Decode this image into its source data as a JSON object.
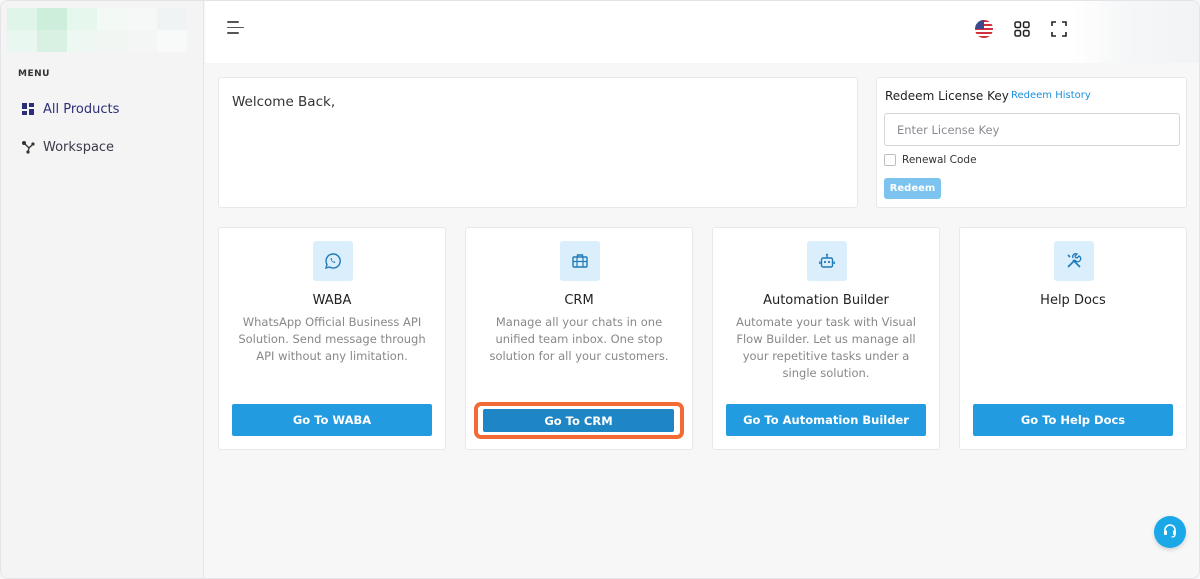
{
  "sidebar": {
    "menu_label": "MENU",
    "items": [
      {
        "label": "All Products",
        "icon": "grid-icon"
      },
      {
        "label": "Workspace",
        "icon": "nodes-icon"
      }
    ]
  },
  "topbar": {
    "language_icon": "us-flag-icon",
    "apps_icon": "apps-grid-icon",
    "fullscreen_icon": "fullscreen-icon"
  },
  "welcome": {
    "text": "Welcome Back,"
  },
  "redeem": {
    "title": "Redeem License Key",
    "history_link": "Redeem History",
    "input_placeholder": "Enter License Key",
    "input_value": "",
    "renewal_label": "Renewal Code",
    "button_label": "Redeem"
  },
  "products": [
    {
      "title": "WABA",
      "icon": "whatsapp-icon",
      "description": "WhatsApp Official Business API Solution. Send message through API without any limitation.",
      "button_label": "Go To WABA"
    },
    {
      "title": "CRM",
      "icon": "briefcase-icon",
      "description": "Manage all your chats in one unified team inbox. One stop solution for all your customers.",
      "button_label": "Go To CRM"
    },
    {
      "title": "Automation Builder",
      "icon": "robot-icon",
      "description": "Automate your task with Visual Flow Builder. Let us manage all your repetitive tasks under a single solution.",
      "button_label": "Go To Automation Builder"
    },
    {
      "title": "Help Docs",
      "icon": "tools-icon",
      "description": "",
      "button_label": "Go To Help Docs"
    }
  ],
  "colors": {
    "accent": "#239be0",
    "highlight": "#f26b35",
    "icon_bg": "#dbeefb"
  }
}
